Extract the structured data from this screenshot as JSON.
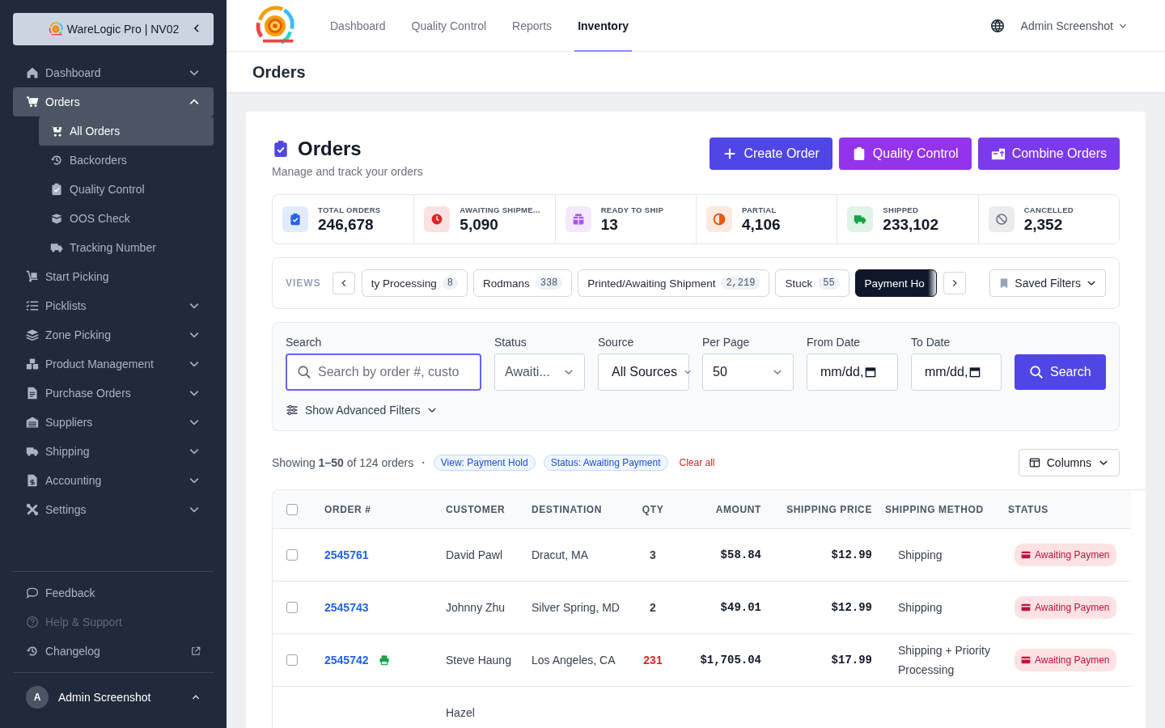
{
  "sidebar": {
    "brand": "WareLogic Pro | NV02",
    "items": [
      {
        "label": "Dashboard",
        "expanded": false,
        "selected": false
      },
      {
        "label": "Orders",
        "expanded": true,
        "selected": true,
        "children": [
          {
            "label": "All Orders",
            "selected": true
          },
          {
            "label": "Backorders",
            "selected": false
          },
          {
            "label": "Quality Control",
            "selected": false
          },
          {
            "label": "OOS Check",
            "selected": false
          },
          {
            "label": "Tracking Number",
            "selected": false
          }
        ]
      },
      {
        "label": "Start Picking",
        "selected": false
      },
      {
        "label": "Picklists",
        "expanded": false,
        "selected": false
      },
      {
        "label": "Zone Picking",
        "expanded": false,
        "selected": false
      },
      {
        "label": "Product Management",
        "expanded": false,
        "selected": false
      },
      {
        "label": "Purchase Orders",
        "expanded": false,
        "selected": false
      },
      {
        "label": "Suppliers",
        "expanded": false,
        "selected": false
      },
      {
        "label": "Shipping",
        "expanded": false,
        "selected": false
      },
      {
        "label": "Accounting",
        "expanded": false,
        "selected": false
      },
      {
        "label": "Settings",
        "expanded": false,
        "selected": false
      }
    ],
    "footer": [
      {
        "label": "Feedback",
        "disabled": false,
        "external": false
      },
      {
        "label": "Help & Support",
        "disabled": true,
        "external": false
      },
      {
        "label": "Changelog",
        "disabled": false,
        "external": true
      }
    ],
    "user": {
      "initial": "A",
      "name": "Admin Screenshot"
    }
  },
  "topbar": {
    "tabs": [
      {
        "label": "Dashboard",
        "selected": false
      },
      {
        "label": "Quality Control",
        "selected": false
      },
      {
        "label": "Reports",
        "selected": false
      },
      {
        "label": "Inventory",
        "selected": true
      }
    ],
    "user": "Admin Screenshot"
  },
  "page_title": "Orders",
  "header": {
    "title": "Orders",
    "subtitle": "Manage and track your orders",
    "buttons": [
      {
        "label": "Create Order",
        "color": "#4f46e5"
      },
      {
        "label": "Quality Control",
        "color": "#9333ea"
      },
      {
        "label": "Combine Orders",
        "color": "#7c3aed"
      }
    ]
  },
  "stats": [
    {
      "label": "TOTAL ORDERS",
      "value": "246,678",
      "color": "#2563eb"
    },
    {
      "label": "AWAITING SHIPME...",
      "value": "5,090",
      "color": "#dc2626"
    },
    {
      "label": "READY TO SHIP",
      "value": "13",
      "color": "#a855f7"
    },
    {
      "label": "PARTIAL",
      "value": "4,106",
      "color": "#ea580c"
    },
    {
      "label": "SHIPPED",
      "value": "233,102",
      "color": "#16a34a"
    },
    {
      "label": "CANCELLED",
      "value": "2,352",
      "color": "#6b7280"
    }
  ],
  "views": {
    "label": "VIEWS",
    "chips": [
      {
        "label": "ty Processing",
        "count": "8",
        "selected": false
      },
      {
        "label": "Rodmans",
        "count": "338",
        "selected": false
      },
      {
        "label": "Printed/Awaiting Shipment",
        "count": "2,219",
        "selected": false
      },
      {
        "label": "Stuck",
        "count": "55",
        "selected": false
      },
      {
        "label": "Payment Ho",
        "selected": true
      }
    ],
    "saved": "Saved Filters"
  },
  "filters": {
    "fields": [
      {
        "label": "Search",
        "kind": "search",
        "placeholder": "Search by order #, custo"
      },
      {
        "label": "Status",
        "kind": "select",
        "value": "Awaiti..."
      },
      {
        "label": "Source",
        "kind": "source",
        "value": "All Sources"
      },
      {
        "label": "Per Page",
        "kind": "select",
        "value": "50"
      },
      {
        "label": "From Date",
        "kind": "date",
        "value": "mm/dd,"
      },
      {
        "label": "To Date",
        "kind": "date",
        "value": "mm/dd,"
      }
    ],
    "button": "Search",
    "advanced": "Show Advanced Filters"
  },
  "summary": {
    "text": "Showing **1–50** of 124 orders",
    "separator": "·",
    "chips": [
      "View: Payment Hold",
      "Status: Awaiting Payment"
    ],
    "clear": "Clear all",
    "columns": "Columns"
  },
  "table": {
    "select_all_checked": false,
    "columns": [
      "ORDER #",
      "CUSTOMER",
      "DESTINATION",
      "QTY",
      "AMOUNT",
      "SHIPPING PRICE",
      "SHIPPING METHOD",
      "STATUS"
    ],
    "rows": [
      {
        "checked": false,
        "order": "2545761",
        "printed": false,
        "customer": "David Pawl",
        "destination": "Dracut, MA",
        "qty": "3",
        "qty_alert": false,
        "amount": "$58.84",
        "shipping_price": "$12.99",
        "method": "Shipping",
        "status": "Awaiting Paymen"
      },
      {
        "checked": false,
        "order": "2545743",
        "printed": false,
        "customer": "Johnny Zhu",
        "destination": "Silver Spring, MD",
        "qty": "2",
        "qty_alert": false,
        "amount": "$49.01",
        "shipping_price": "$12.99",
        "method": "Shipping",
        "status": "Awaiting Paymen"
      },
      {
        "checked": false,
        "order": "2545742",
        "printed": true,
        "customer": "Steve Haung",
        "destination": "Los Angeles, CA",
        "qty": "231",
        "qty_alert": true,
        "amount": "$1,705.04",
        "shipping_price": "$17.99",
        "method": "Shipping + Priority Processing",
        "status": "Awaiting Paymen"
      },
      {
        "customer": "Hazel"
      }
    ]
  }
}
